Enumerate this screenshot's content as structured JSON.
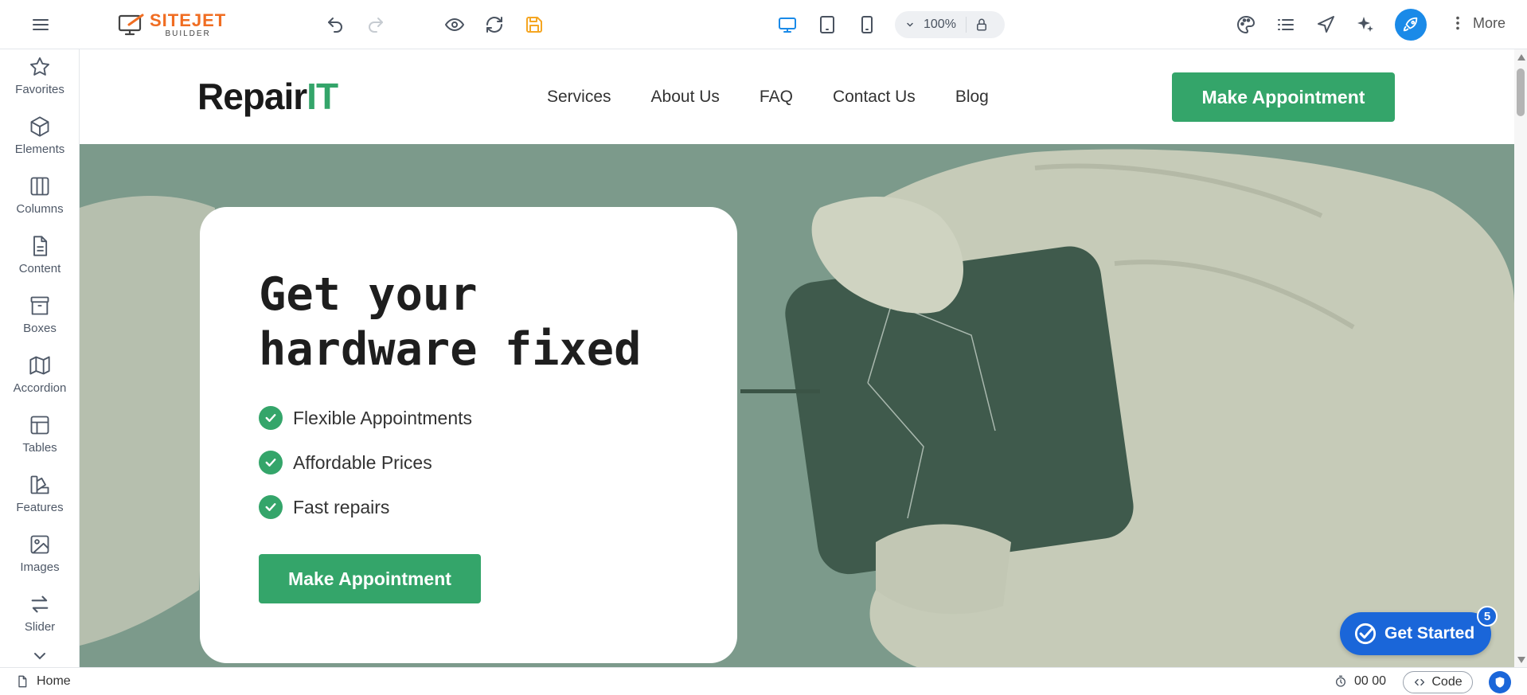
{
  "app": {
    "brand_name": "SITEJET",
    "brand_sub": "BUILDER"
  },
  "toolbar": {
    "icons": {
      "menu": "hamburger-icon",
      "undo": "undo-icon",
      "redo": "redo-icon",
      "preview": "eye-icon",
      "reload": "refresh-icon",
      "save": "save-icon",
      "desktop": "desktop-icon",
      "tablet": "tablet-icon",
      "mobile": "mobile-icon",
      "lock": "lock-icon",
      "design": "palette-icon",
      "structure": "list-icon",
      "navigator": "navigation-icon",
      "ai": "sparkle-icon",
      "publish": "rocket-icon"
    },
    "zoom": "100%",
    "more_label": "More",
    "colors": {
      "active_device": "#1a8ae8",
      "save_icon": "#f5a623",
      "publish_bg": "#1a8ae8"
    }
  },
  "sidebar": {
    "items": [
      {
        "label": "Favorites",
        "icon": "star-icon"
      },
      {
        "label": "Elements",
        "icon": "cube-icon"
      },
      {
        "label": "Columns",
        "icon": "columns-icon"
      },
      {
        "label": "Content",
        "icon": "document-icon"
      },
      {
        "label": "Boxes",
        "icon": "archive-icon"
      },
      {
        "label": "Accordion",
        "icon": "map-icon"
      },
      {
        "label": "Tables",
        "icon": "table-icon"
      },
      {
        "label": "Features",
        "icon": "swatches-icon"
      },
      {
        "label": "Images",
        "icon": "image-icon"
      },
      {
        "label": "Slider",
        "icon": "arrows-swap-icon"
      }
    ]
  },
  "site": {
    "logo_main": "Repair",
    "logo_accent": "IT",
    "nav": [
      "Services",
      "About Us",
      "FAQ",
      "Contact Us",
      "Blog"
    ],
    "header_cta": "Make Appointment",
    "hero": {
      "title_line1": "Get your",
      "title_line2": "hardware fixed",
      "features": [
        "Flexible Appointments",
        "Affordable Prices",
        "Fast repairs"
      ],
      "cta": "Make Appointment"
    },
    "accent_color": "#34a56a"
  },
  "get_started": {
    "label": "Get Started",
    "badge": "5"
  },
  "bottombar": {
    "page": "Home",
    "timer": "00 00",
    "code_label": "Code"
  }
}
